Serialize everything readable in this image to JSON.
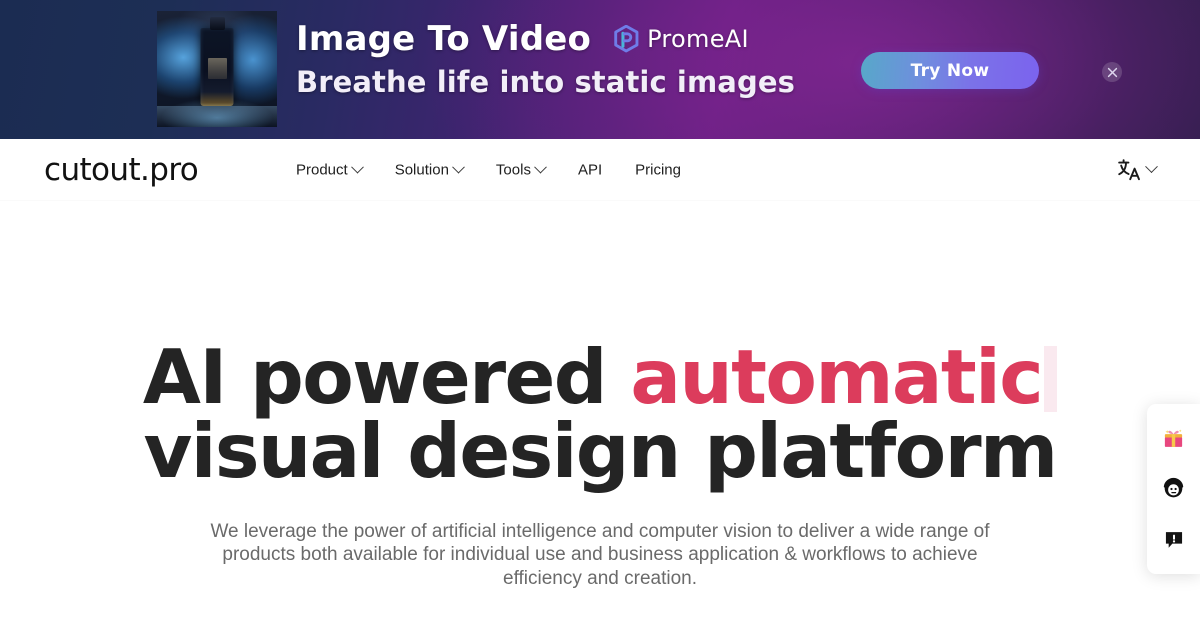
{
  "ad": {
    "headline_line1": "Image To Video",
    "headline_line2": "Breathe life into static images",
    "brand_name": "PromeAI",
    "cta_label": "Try Now",
    "close_label": "×",
    "thumbnail_alt": "perfume-bottle-water-splash",
    "colors": {
      "gradient_start": "#1b2c52",
      "gradient_mid": "#6e2089",
      "gradient_end": "#2e1f4a",
      "cta_from": "#57a8c9",
      "cta_to": "#7b63ee"
    }
  },
  "nav": {
    "brand": "cutout.pro",
    "items": [
      {
        "label": "Product",
        "has_dropdown": true
      },
      {
        "label": "Solution",
        "has_dropdown": true
      },
      {
        "label": "Tools",
        "has_dropdown": true
      },
      {
        "label": "API",
        "has_dropdown": false
      },
      {
        "label": "Pricing",
        "has_dropdown": false
      }
    ],
    "language_icon": "translate-icon",
    "language_has_dropdown": true
  },
  "hero": {
    "title_line1_prefix": "AI powered ",
    "title_line1_accent": "automatic",
    "title_line2": "visual design platform",
    "accent_color": "#dc3c5c",
    "caret_color": "#fae9ef",
    "subtitle": "We leverage the power of artificial intelligence and computer vision to deliver a wide range of products both available for individual use and business application & workflows to achieve efficiency and creation."
  },
  "side_widget": {
    "buttons": [
      {
        "icon": "gift-icon",
        "label": "Gifts"
      },
      {
        "icon": "support-agent-icon",
        "label": "Support"
      },
      {
        "icon": "feedback-icon",
        "label": "Feedback"
      }
    ]
  }
}
